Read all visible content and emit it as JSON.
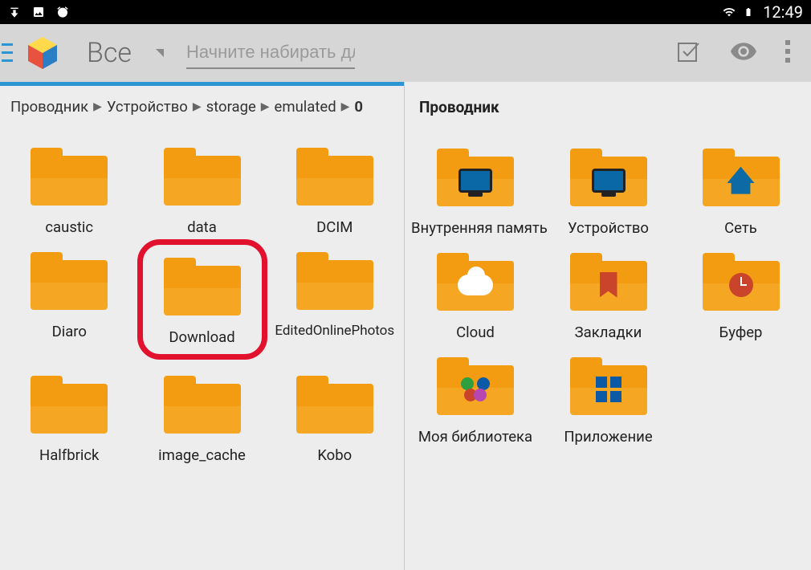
{
  "status_bar": {
    "time": "12:49"
  },
  "header": {
    "filter_label": "Все",
    "search_placeholder": "Начните набирать дл"
  },
  "left_pane": {
    "breadcrumb": [
      "Проводник",
      "Устройство",
      "storage",
      "emulated",
      "0"
    ],
    "items": [
      {
        "label": "caustic",
        "type": "folder"
      },
      {
        "label": "data",
        "type": "folder"
      },
      {
        "label": "DCIM",
        "type": "folder"
      },
      {
        "label": "Diaro",
        "type": "folder"
      },
      {
        "label": "Download",
        "type": "folder",
        "highlighted": true
      },
      {
        "label": "EditedOnlinePhotos",
        "type": "folder",
        "long": true
      },
      {
        "label": "Halfbrick",
        "type": "folder"
      },
      {
        "label": "image_cache",
        "type": "folder"
      },
      {
        "label": "Kobo",
        "type": "folder"
      }
    ]
  },
  "right_pane": {
    "title": "Проводник",
    "items": [
      {
        "label": "Внутренняя память",
        "overlay": "monitor"
      },
      {
        "label": "Устройство",
        "overlay": "monitor"
      },
      {
        "label": "Сеть",
        "overlay": "network"
      },
      {
        "label": "Cloud",
        "overlay": "cloud"
      },
      {
        "label": "Закладки",
        "overlay": "bookmark"
      },
      {
        "label": "Буфер",
        "overlay": "clock"
      },
      {
        "label": "Моя библиотека",
        "overlay": "lib"
      },
      {
        "label": "Приложение",
        "overlay": "apps"
      }
    ]
  }
}
